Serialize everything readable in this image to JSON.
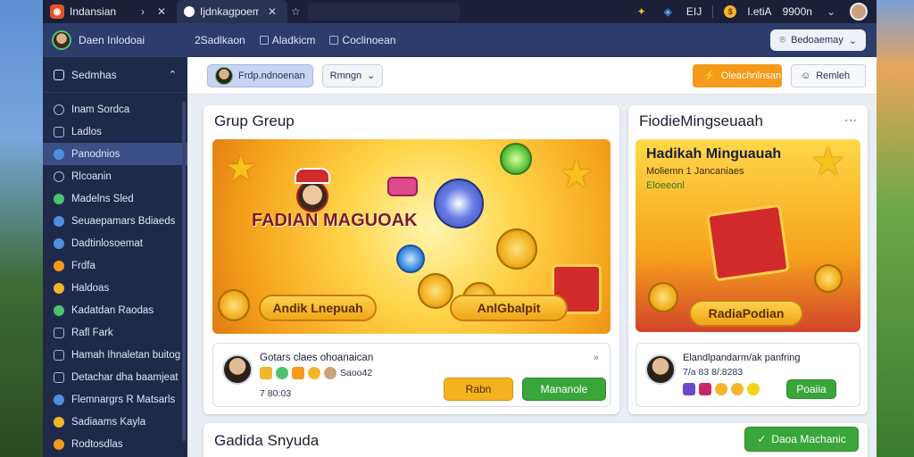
{
  "topbar": {
    "app_title": "Indansian",
    "active_tab_title": "Ijdnkagpoemau",
    "right_text_1": "EIJ",
    "coins_value": "I.etiA",
    "extra_value": "9900n"
  },
  "subbar": {
    "user_name": "Daen Inlodoai",
    "link_1": "2Sadlkaon",
    "link_2": "Aladkicm",
    "link_3": "Coclinoean",
    "pill_label": "Bedoaemay"
  },
  "sidebar": {
    "header": "Sedmhas",
    "items": [
      {
        "label": "Inam Sordca",
        "icon": "search-icon",
        "color": "#aab6d6"
      },
      {
        "label": "Ladlos",
        "icon": "list-icon",
        "color": "#aab6d6"
      },
      {
        "label": "Panodnios",
        "icon": "globe-icon",
        "color": "#4f8fe0"
      },
      {
        "label": "Rlcoanin",
        "icon": "settings-icon",
        "color": "#aab6d6"
      },
      {
        "label": "Madelns Sled",
        "icon": "users-icon",
        "color": "#4ec26e"
      },
      {
        "label": "Seuaepamars Bdiaeds",
        "icon": "group-icon",
        "color": "#4f8fe0"
      },
      {
        "label": "Dadtinlosoemat",
        "icon": "info-icon",
        "color": "#4f8fe0"
      },
      {
        "label": "Frdfa",
        "icon": "fire-icon",
        "color": "#f59a1b"
      },
      {
        "label": "Haldoas",
        "icon": "smile-icon",
        "color": "#f3b52a"
      },
      {
        "label": "Kadatdan Raodas",
        "icon": "chat-icon",
        "color": "#4ec26e"
      },
      {
        "label": "Rafl Fark",
        "icon": "chart-icon",
        "color": "#aab6d6"
      },
      {
        "label": "Hamah Ihnaletan buitog",
        "icon": "doc-icon",
        "color": "#aab6d6"
      },
      {
        "label": "Detachar dha baamjeat",
        "icon": "mail-icon",
        "color": "#aab6d6"
      },
      {
        "label": "Flemnargrs R Matsarls",
        "icon": "globe-icon",
        "color": "#4f8fe0"
      },
      {
        "label": "Sadiaams Kayla",
        "icon": "star-icon",
        "color": "#f3b52a"
      },
      {
        "label": "Rodtosdlas",
        "icon": "gift-icon",
        "color": "#f59a1b"
      }
    ]
  },
  "toolbar": {
    "user_chip": "Frdp.ndnoenan",
    "select_value": "Rmngn",
    "orange_button": "Oleachnlnsan",
    "light_button": "Remleh"
  },
  "card_left": {
    "title": "Grup Greup",
    "banner_title": "FADIAN MAGUOAK",
    "pill_1": "Andik Lnepuah",
    "pill_2": "AnlGbalpit",
    "info_name": "Gotars claes ohoanaican",
    "info_badge_text": "Saoo42",
    "info_number": "7 80:03",
    "btn_yellow": "Rabn",
    "btn_green": "Mananole"
  },
  "card_right": {
    "title": "FiodieMingseuaah",
    "banner_heading": "Hadikah Minguauah",
    "banner_line_1": "Moliemn 1 Jancaniaes",
    "banner_line_2": "Eloeeonl",
    "pill": "RadiaPodian",
    "info_name": "Elandlpandarm/ak panfring",
    "info_number": "7/a 83 8/:8283",
    "btn_green": "Poaiia"
  },
  "card_bottom": {
    "title": "Gadida Snyuda",
    "btn_green": "Daoa Machanic"
  }
}
